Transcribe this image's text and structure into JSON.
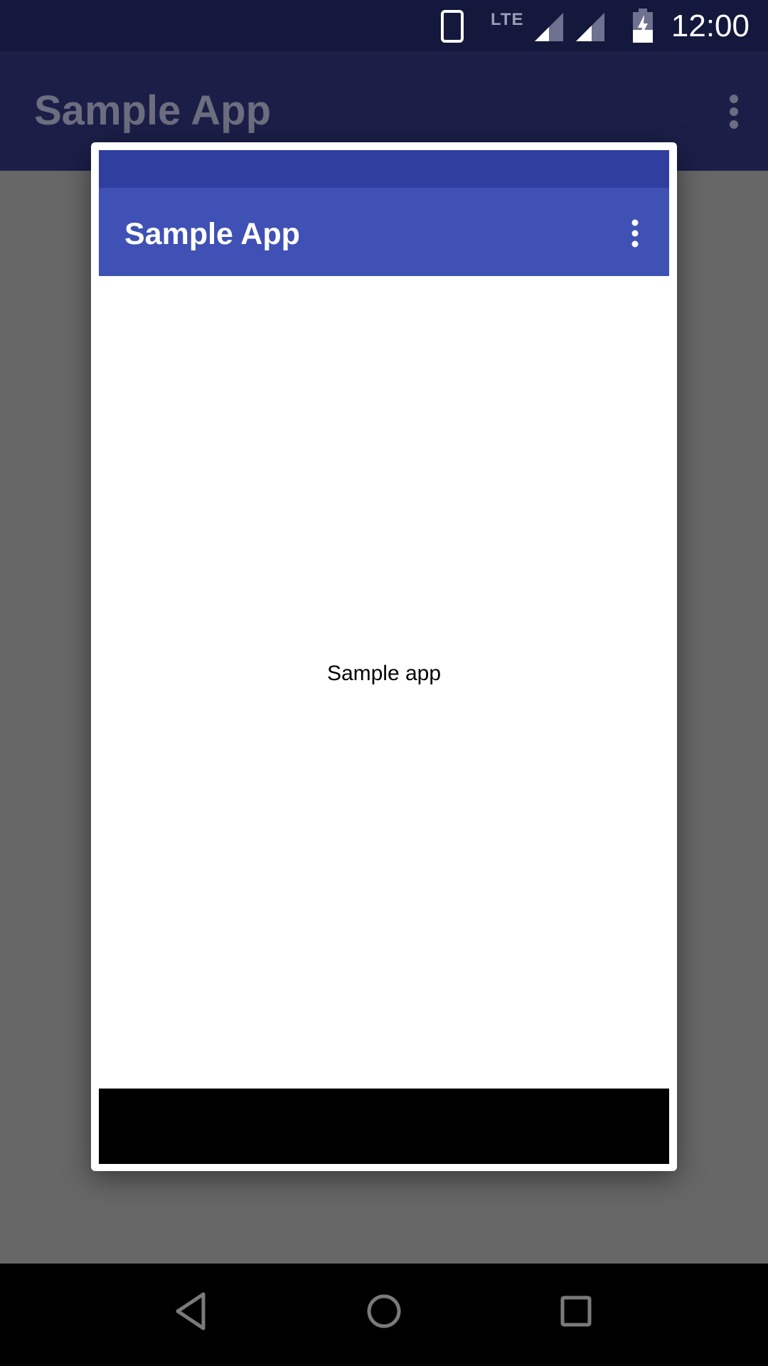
{
  "status_bar": {
    "time": "12:00",
    "network_label": "LTE",
    "icons": [
      "phone-icon",
      "signal-icon",
      "signal-icon",
      "battery-charging-icon"
    ]
  },
  "background_app": {
    "title": "Sample App",
    "menu_icon": "more-vert-icon"
  },
  "preview": {
    "app_title": "Sample App",
    "menu_icon": "more-vert-icon",
    "body_text": "Sample app"
  },
  "nav_bar": {
    "buttons": [
      "back-icon",
      "home-icon",
      "recents-icon"
    ]
  },
  "colors": {
    "status_bar": "#14183c",
    "primary_dark": "#303f9f",
    "primary": "#3f51b5",
    "scrim": "#676767"
  }
}
